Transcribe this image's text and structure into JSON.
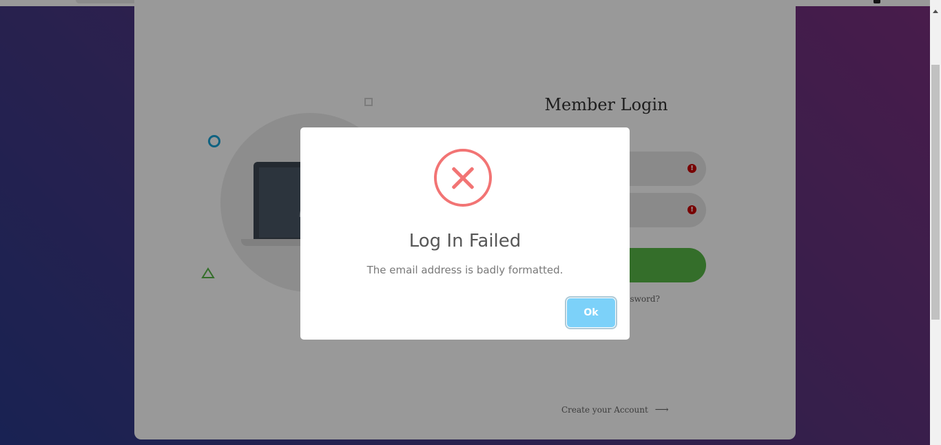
{
  "colors": {
    "background_gradient": [
      "#2a3a8a",
      "#7a2f7d"
    ],
    "card": "#ffffff",
    "login_button": "#57b846",
    "error_accent": "#f27474",
    "ok_button": "#7cd1f9",
    "alert_icon": "#c80000"
  },
  "login": {
    "title": "Member Login",
    "email_field": {
      "value": "",
      "placeholder": "",
      "status": "invalid",
      "alert_icon": "!"
    },
    "password_field": {
      "value": "",
      "placeholder": "",
      "status": "invalid",
      "alert_icon": "!"
    },
    "login_button_label": "",
    "forgot_text": "ssword?",
    "create_account_text": "Create your Account",
    "create_account_arrow": "⟶"
  },
  "illustration": {
    "icons": [
      "laptop-icon",
      "user-icon",
      "ring-icon",
      "square-icon",
      "triangle-icon"
    ]
  },
  "modal": {
    "icon": "error-x-icon",
    "title": "Log In Failed",
    "message": "The email address is badly formatted.",
    "ok_label": "Ok"
  }
}
